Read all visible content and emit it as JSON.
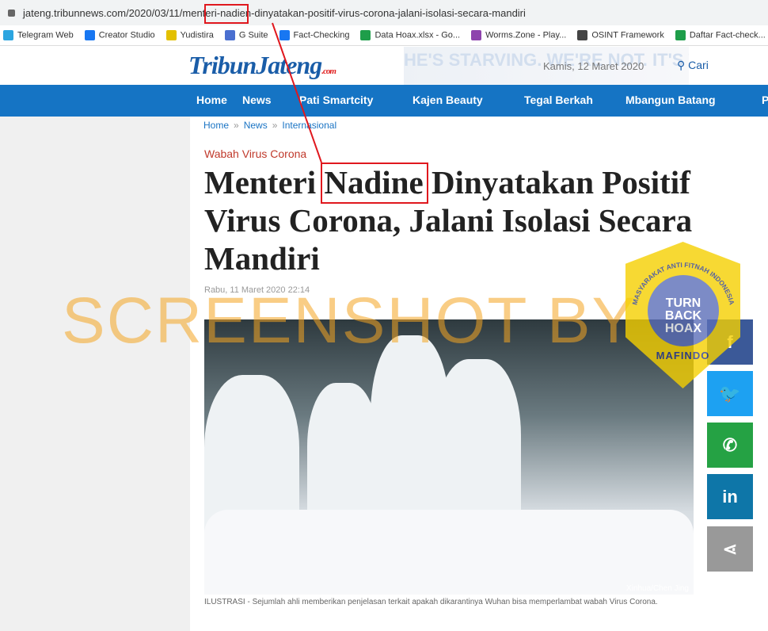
{
  "browser": {
    "url": "jateng.tribunnews.com/2020/03/11/menteri-nadien-dinyatakan-positif-virus-corona-jalani-isolasi-secara-mandiri",
    "bookmarks": [
      {
        "label": "Telegram Web",
        "color": "#2ca5e0"
      },
      {
        "label": "Creator Studio",
        "color": "#1877f2"
      },
      {
        "label": "Yudistira",
        "color": "#e3c000"
      },
      {
        "label": "G Suite",
        "color": "#4a6fd0"
      },
      {
        "label": "Fact-Checking",
        "color": "#1877f2"
      },
      {
        "label": "Data Hoax.xlsx - Go...",
        "color": "#1e9e4a"
      },
      {
        "label": "Worms.Zone - Play...",
        "color": "#8e44ad"
      },
      {
        "label": "OSINT Framework",
        "color": "#444444"
      },
      {
        "label": "Daftar Fact-check...",
        "color": "#1e9e4a"
      }
    ]
  },
  "header": {
    "logo": "TribunJateng",
    "logo_suffix": ".com",
    "date": "Kamis, 12 Maret 2020",
    "search": "Cari",
    "ad_text": "HE'S STARVING. WE'RE NOT. IT'S TIME TO SHARE."
  },
  "nav": [
    "Home",
    "News",
    "Pati Smartcity",
    "Kajen Beauty",
    "Tegal Berkah",
    "Mbangun Batang",
    "P"
  ],
  "breadcrumb": [
    "Home",
    "News",
    "Internasional"
  ],
  "article": {
    "category": "Wabah Virus Corona",
    "title_pre": "Menteri ",
    "title_hl": "Nadine",
    "title_post": " Dinyatakan Positif Virus Corona, Jalani Isolasi Secara Mandiri",
    "date": "Rabu, 11 Maret 2020 22:14",
    "credit": "Xinhua/Chen Jing",
    "caption": "ILUSTRASI - Sejumlah ahli memberikan penjelasan terkait apakah dikarantinya Wuhan bisa memperlambat wabah Virus Corona."
  },
  "share": [
    {
      "icon": "facebook-icon",
      "glyph": "f",
      "color": "#3b5998"
    },
    {
      "icon": "twitter-icon",
      "glyph": "🐦",
      "color": "#1da1f2"
    },
    {
      "icon": "whatsapp-icon",
      "glyph": "✆",
      "color": "#25a244"
    },
    {
      "icon": "linkedin-icon",
      "glyph": "in",
      "color": "#0e76a8"
    },
    {
      "icon": "share-icon",
      "glyph": "⋖",
      "color": "#999999"
    }
  ],
  "watermark": "SCREENSHOT BY",
  "badge": {
    "text": "TURN BACK HOAX",
    "ring": "MASYARAKAT ANTI FITNAH INDONESIA",
    "name": "MAFINDO"
  },
  "colors": {
    "accent": "#1574c4",
    "annotation": "#e0181e"
  }
}
